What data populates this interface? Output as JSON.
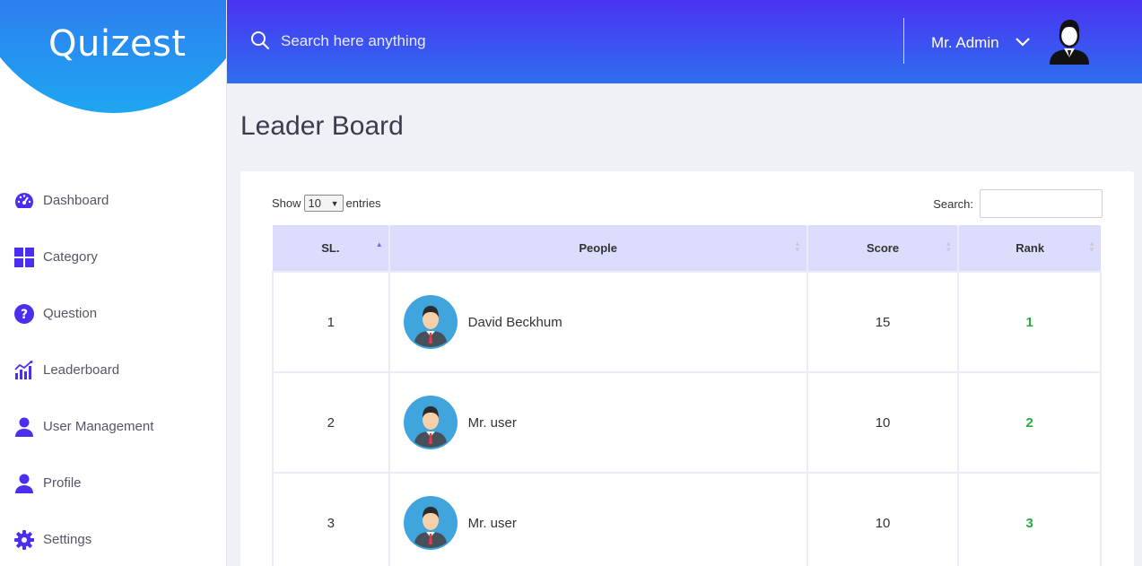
{
  "brand": {
    "name": "Quizest"
  },
  "header": {
    "search_placeholder": "Search here anything",
    "user_name": "Mr. Admin"
  },
  "sidebar": {
    "items": [
      {
        "label": "Dashboard",
        "icon": "dashboard-icon"
      },
      {
        "label": "Category",
        "icon": "grid-icon"
      },
      {
        "label": "Question",
        "icon": "question-icon"
      },
      {
        "label": "Leaderboard",
        "icon": "chart-icon"
      },
      {
        "label": "User Management",
        "icon": "user-icon"
      },
      {
        "label": "Profile",
        "icon": "user-icon"
      },
      {
        "label": "Settings",
        "icon": "gear-icon"
      }
    ]
  },
  "main": {
    "title": "Leader Board",
    "show_label": "Show",
    "entries_value": "10",
    "entries_label": "entries",
    "search_label": "Search:",
    "columns": [
      "SL.",
      "People",
      "Score",
      "Rank"
    ],
    "rows": [
      {
        "sl": "1",
        "name": "David Beckhum",
        "score": "15",
        "rank": "1"
      },
      {
        "sl": "2",
        "name": "Mr. user",
        "score": "10",
        "rank": "2"
      },
      {
        "sl": "3",
        "name": "Mr. user",
        "score": "10",
        "rank": "3"
      }
    ]
  },
  "colors": {
    "accent": "#4a33f2",
    "header_gradient_end": "#2f6ef0",
    "table_header": "#dcdcfd",
    "rank_green": "#27ae3e",
    "icon_purple": "#4a2ff0"
  }
}
